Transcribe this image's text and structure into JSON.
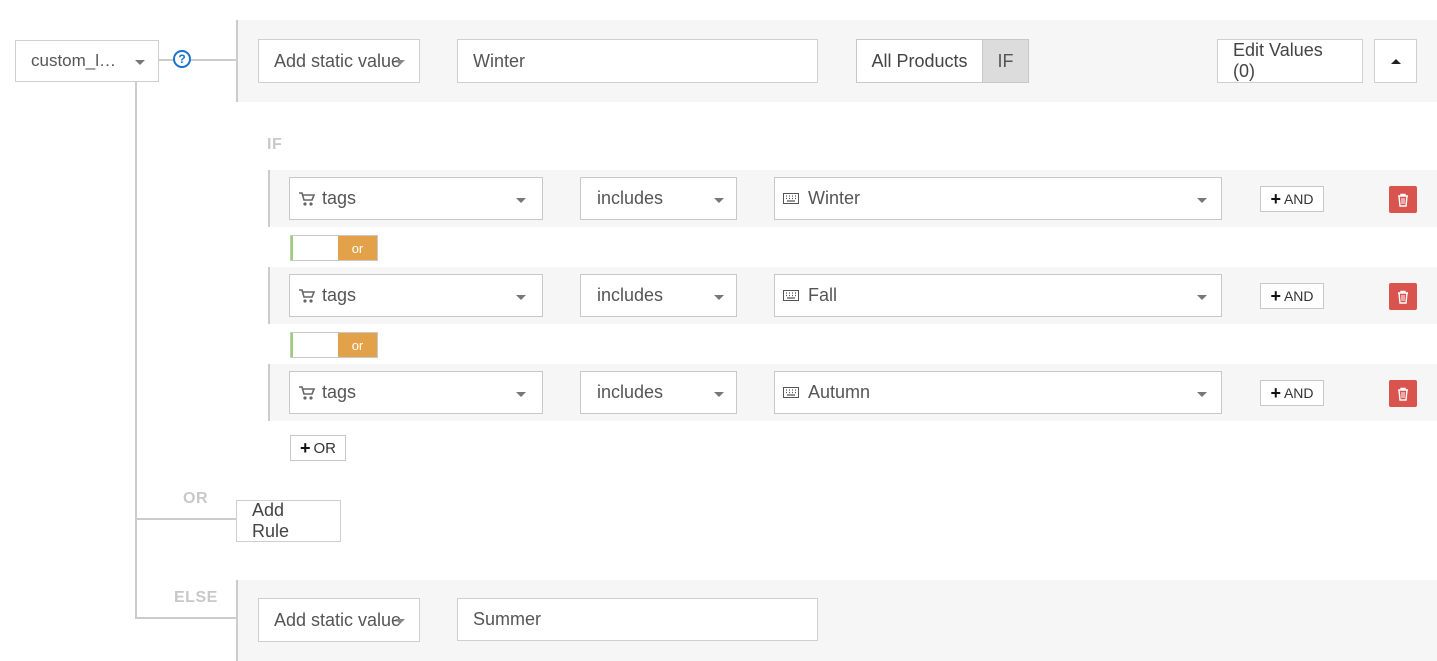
{
  "root_selector": {
    "value": "custom_l…"
  },
  "help_icon": "question-circle-icon",
  "header": {
    "static_select": "Add static value",
    "value_input": "Winter",
    "all_products": "All Products",
    "if_button": "IF",
    "edit_values": "Edit Values (0)"
  },
  "if_label": "IF",
  "conditions": [
    {
      "field": "tags",
      "operator": "includes",
      "value": "Winter",
      "and_label": "AND"
    },
    {
      "field": "tags",
      "operator": "includes",
      "value": "Fall",
      "and_label": "AND"
    },
    {
      "field": "tags",
      "operator": "includes",
      "value": "Autumn",
      "and_label": "AND"
    }
  ],
  "or_toggles": [
    {
      "label": "or"
    },
    {
      "label": "or"
    }
  ],
  "add_or": "OR",
  "or_label": "OR",
  "add_rule": "Add Rule",
  "else_label": "ELSE",
  "else_row": {
    "static_select": "Add static value",
    "value_input": "Summer"
  },
  "colors": {
    "accent_orange": "#e3a14a",
    "delete_red": "#d9534f",
    "help_blue": "#1a73c8",
    "toggle_green": "#9ccf6c"
  }
}
